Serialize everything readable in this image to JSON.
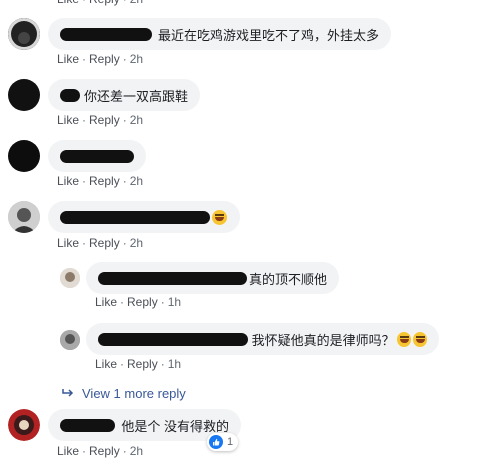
{
  "action_labels": {
    "like": "Like",
    "reply": "Reply",
    "time": "2h",
    "time_reply": "1h"
  },
  "comments": [
    {
      "text": "最近在吃鸡游戏里吃不了鸡，外挂太多",
      "hidden_name": "redacted"
    },
    {
      "text": "你还差一双高跟鞋",
      "hidden_name": "redacted"
    },
    {
      "text": "",
      "hidden_name": "redacted"
    },
    {
      "text": "",
      "hidden_name": "redacted"
    },
    {
      "text": "真的顶不顺他",
      "hidden_name": "redacted"
    },
    {
      "text": "我怀疑他真的是律师吗？",
      "hidden_name": "redacted"
    },
    {
      "text": "他是个 没有得救的",
      "hidden_name": "redacted"
    }
  ],
  "view_more": "View 1 more reply",
  "reaction_count": "1",
  "colors": {
    "link": "#385898",
    "bubble": "#f2f3f5",
    "like_blue": "#1877f2"
  },
  "icons": [
    "laughing-emoji-icon",
    "reply-arrow-icon",
    "like-reaction-icon"
  ]
}
